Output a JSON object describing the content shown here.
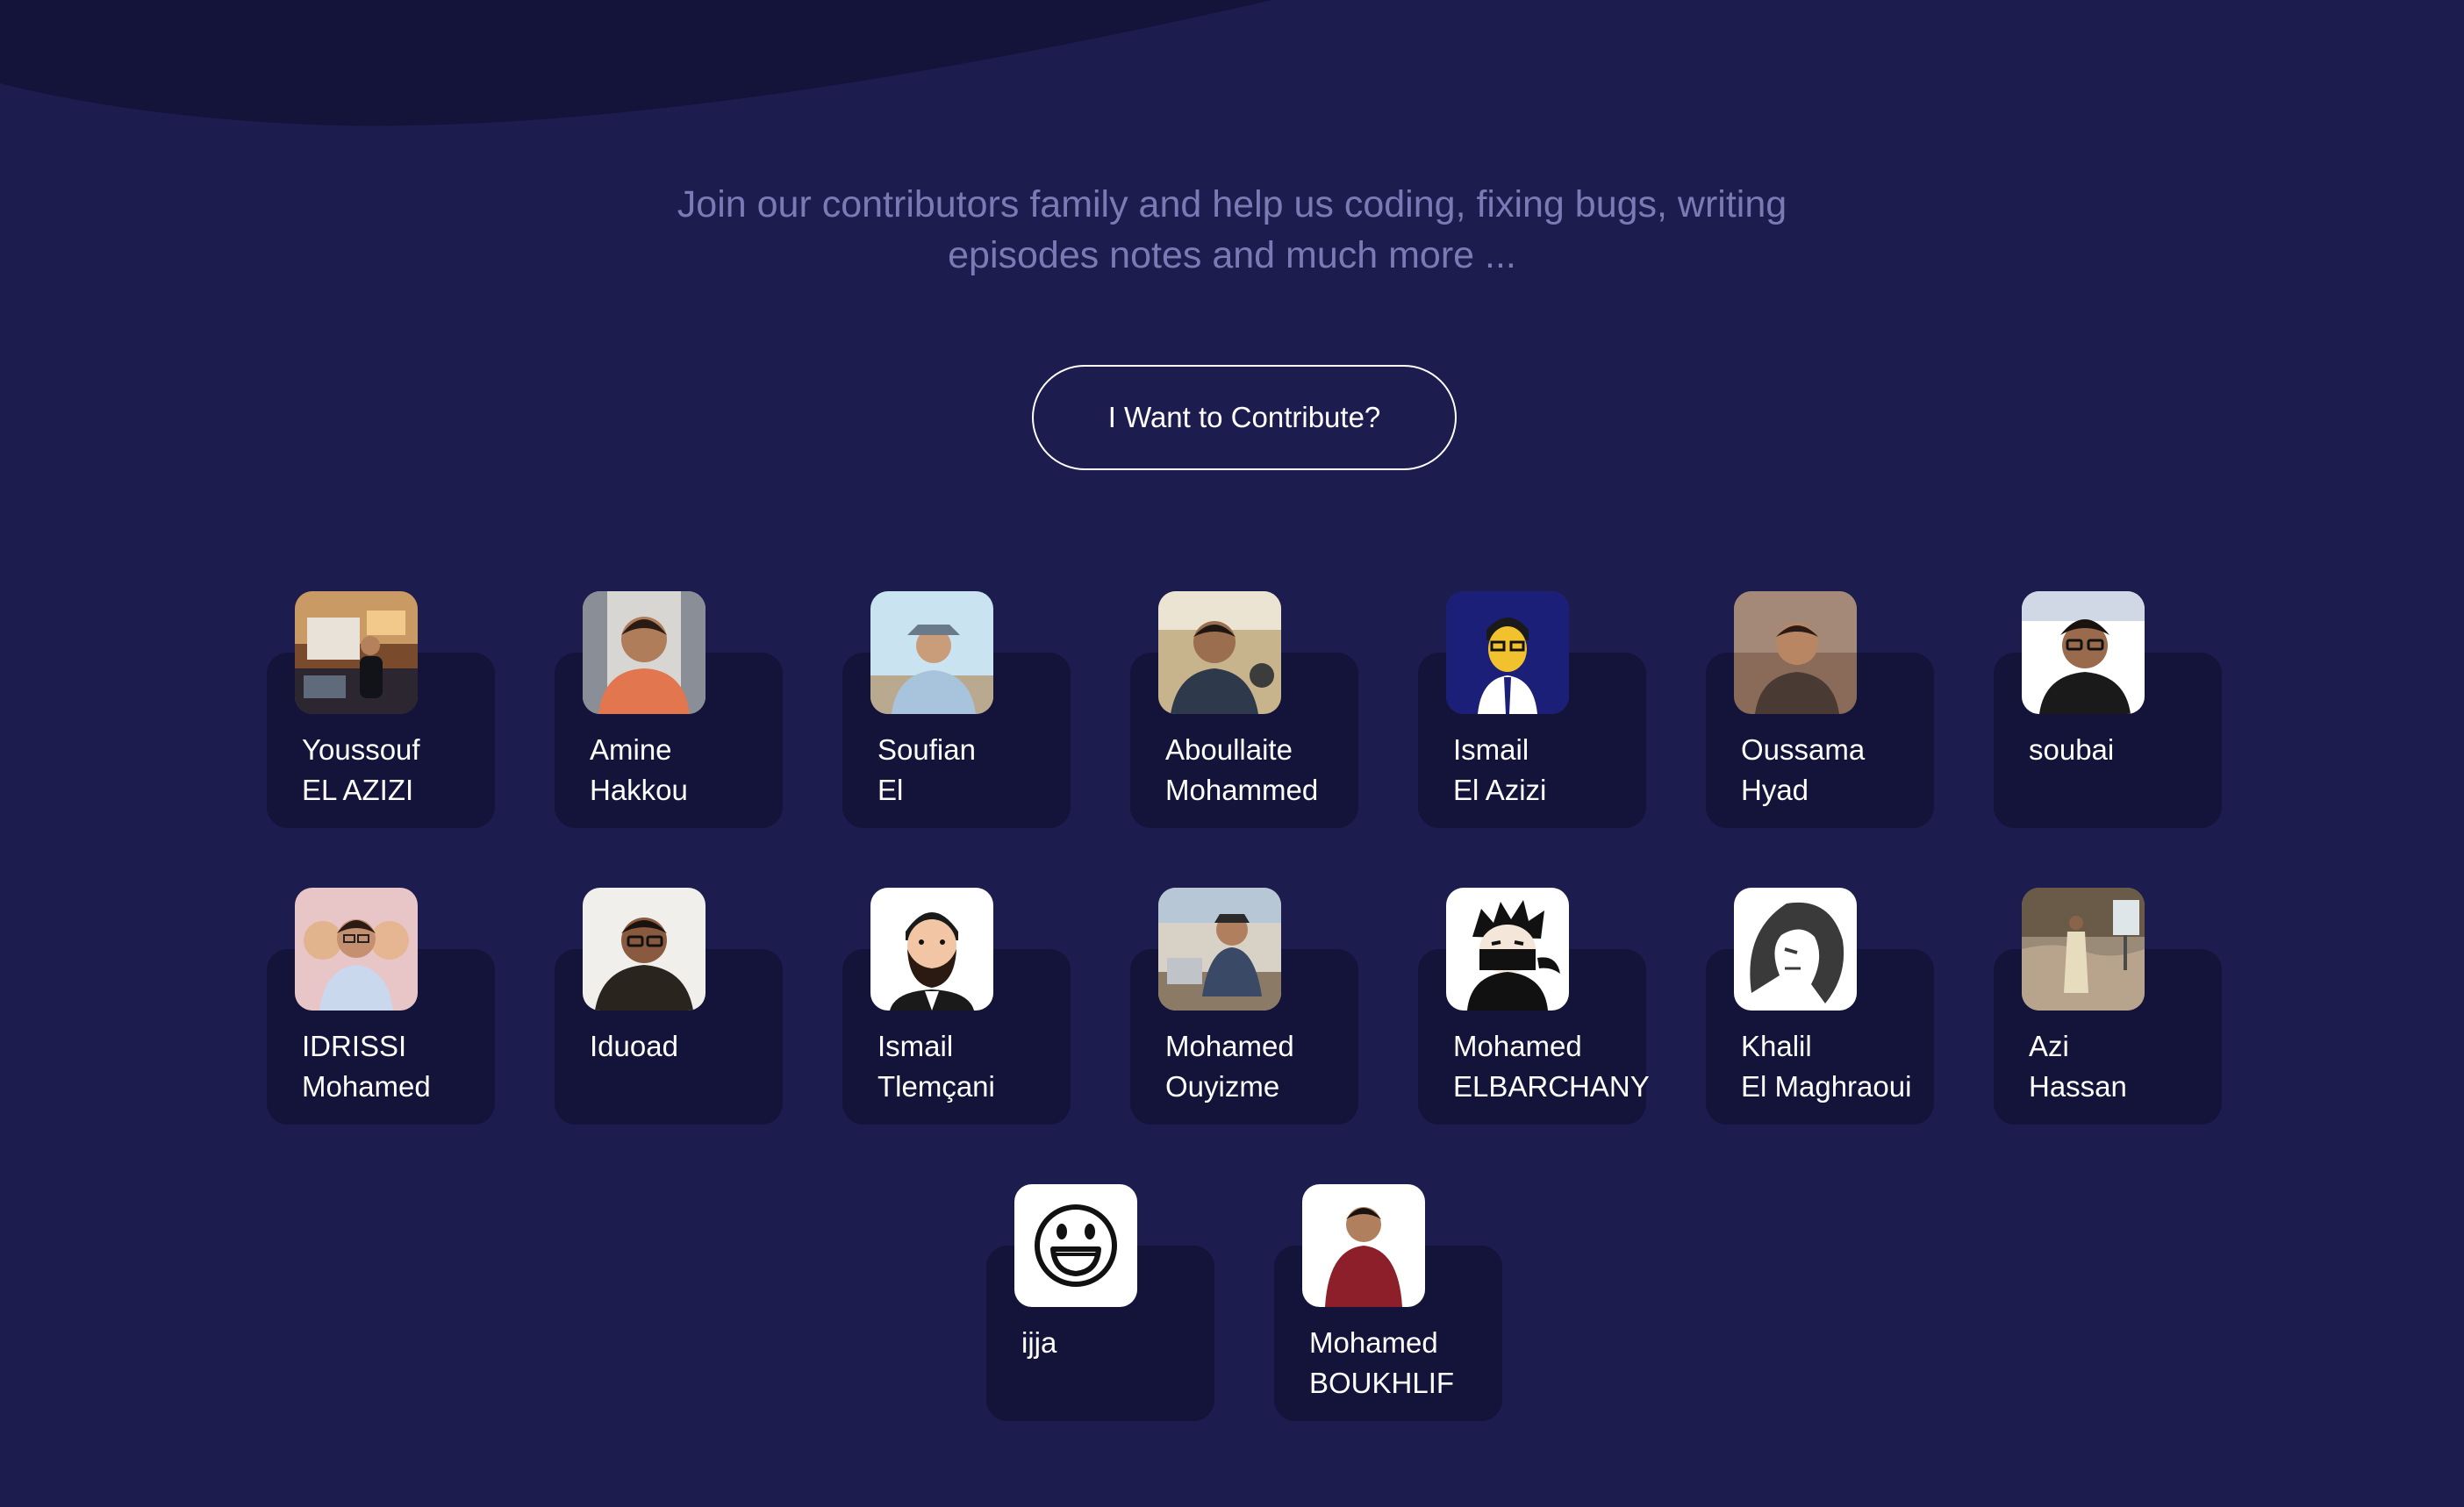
{
  "header": {
    "subtitle_line1": "Join our contributors family and help us coding, fixing bugs, writing",
    "subtitle_line2": "episodes notes and much more ...",
    "cta_label": "I Want to Contribute?"
  },
  "colors": {
    "background": "#1d1c4f",
    "wave": "#141339",
    "card": "#141339",
    "subtitle": "#7b7ab4",
    "text": "#ffffff"
  },
  "contributors": [
    {
      "first": "Youssouf",
      "last": "EL AZIZI",
      "avatar_icon": "speaker-photo-icon"
    },
    {
      "first": "Amine",
      "last": "Hakkou",
      "avatar_icon": "person-photo-icon"
    },
    {
      "first": "Soufian",
      "last": "El",
      "avatar_icon": "person-hat-photo-icon"
    },
    {
      "first": "Aboullaite",
      "last": "Mohammed",
      "avatar_icon": "person-photo-icon"
    },
    {
      "first": "Ismail",
      "last": "El Azizi",
      "avatar_icon": "cartoon-avatar-icon"
    },
    {
      "first": "Oussama",
      "last": "Hyad",
      "avatar_icon": "person-photo-icon"
    },
    {
      "first": "soubai",
      "last": "",
      "avatar_icon": "person-photo-icon"
    },
    {
      "first": "IDRISSI",
      "last": "Mohamed",
      "avatar_icon": "group-photo-icon"
    },
    {
      "first": "Iduoad",
      "last": "",
      "avatar_icon": "person-photo-icon"
    },
    {
      "first": "Ismail",
      "last": "Tlemçani",
      "avatar_icon": "cartoon-beard-icon"
    },
    {
      "first": "Mohamed",
      "last": "Ouyizme",
      "avatar_icon": "person-photo-icon"
    },
    {
      "first": "Mohamed",
      "last": "ELBARCHANY",
      "avatar_icon": "ninja-avatar-icon"
    },
    {
      "first": "Khalil",
      "last": "El Maghraoui",
      "avatar_icon": "hooded-sketch-icon"
    },
    {
      "first": "Azi",
      "last": "Hassan",
      "avatar_icon": "outdoor-photo-icon"
    },
    {
      "first": "ijja",
      "last": "",
      "avatar_icon": "smiley-face-icon"
    },
    {
      "first": "Mohamed",
      "last": "BOUKHLIF",
      "avatar_icon": "person-photo-icon"
    }
  ]
}
